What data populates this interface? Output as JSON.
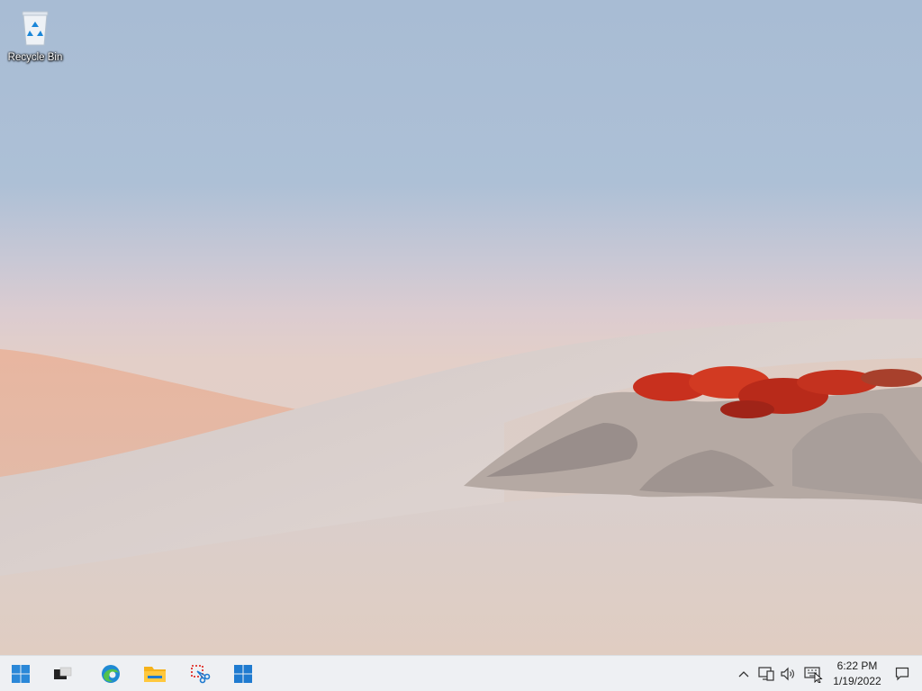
{
  "desktop": {
    "icons": [
      {
        "label": "Recycle Bin",
        "icon": "recycle-bin-icon"
      }
    ]
  },
  "taskbar": {
    "apps": [
      {
        "name": "start",
        "icon": "windows-start-icon"
      },
      {
        "name": "task-view",
        "icon": "task-view-icon"
      },
      {
        "name": "edge",
        "icon": "edge-icon"
      },
      {
        "name": "file-explorer",
        "icon": "folder-icon"
      },
      {
        "name": "snipping-tool",
        "icon": "snipping-tool-icon"
      },
      {
        "name": "microsoft-store",
        "icon": "store-icon"
      }
    ],
    "tray": {
      "icons": [
        "chevron-up-icon",
        "network-icon",
        "volume-icon",
        "keyboard-icon"
      ],
      "time": "6:22 PM",
      "date": "1/19/2022",
      "notifications_icon": "notification-icon"
    }
  },
  "colors": {
    "taskbar_bg": "#eef0f3",
    "windows_blue": "#0078d4",
    "sky": "#a8bcd4",
    "dune": "#ddd0ca",
    "shrub_red": "#c8301e"
  }
}
